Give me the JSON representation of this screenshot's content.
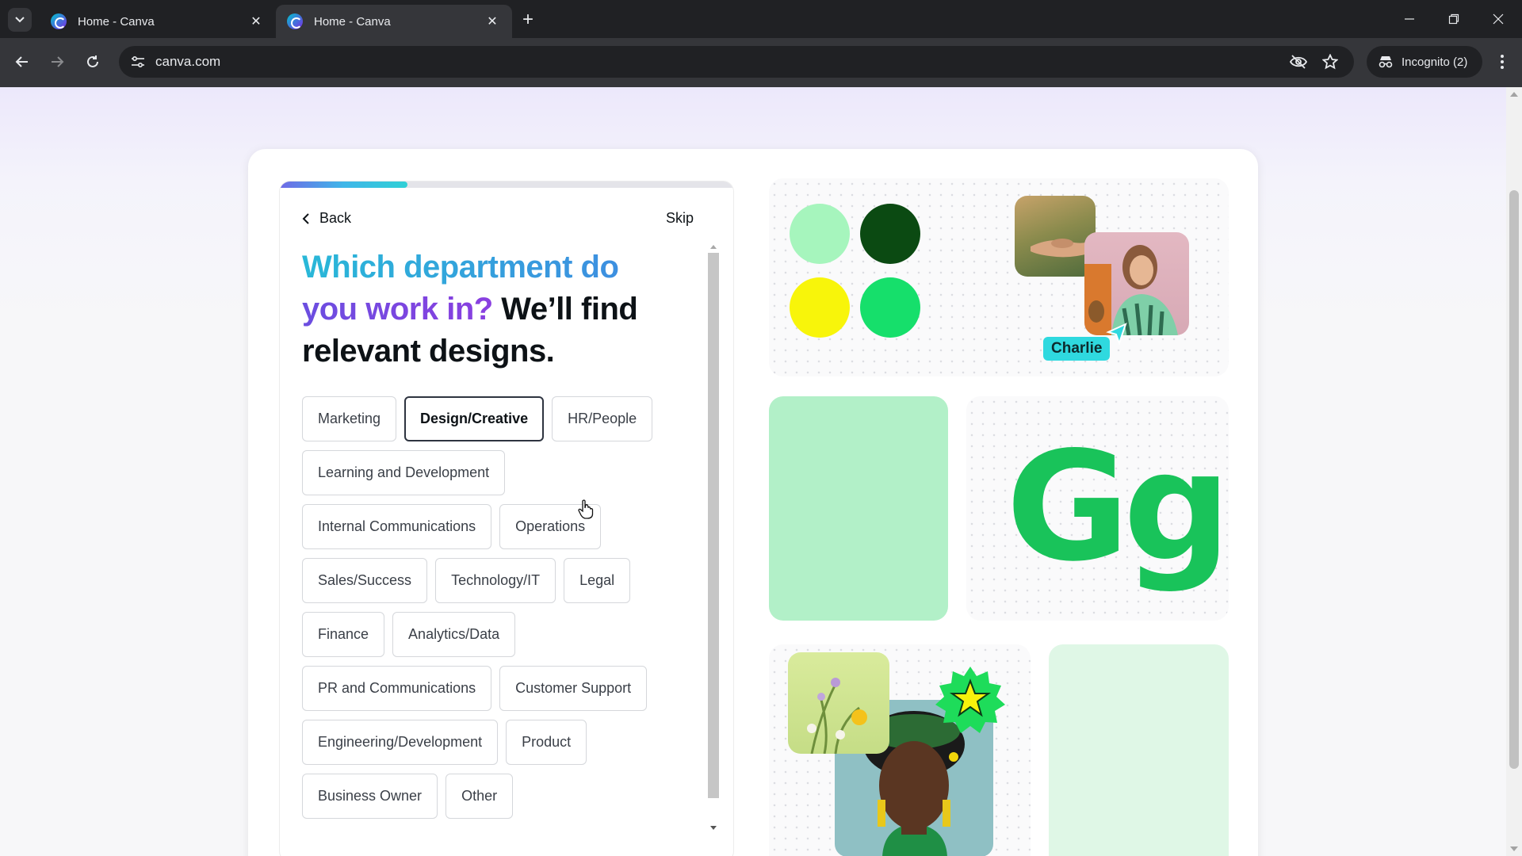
{
  "browser": {
    "tabs": [
      {
        "title": "Home - Canva",
        "active": false
      },
      {
        "title": "Home - Canva",
        "active": true
      }
    ],
    "url": "canva.com",
    "incognito_label": "Incognito (2)",
    "icons": {
      "tab_search": "chevron-down-icon",
      "close": "close-icon",
      "new_tab": "plus-icon",
      "back": "arrow-left-icon",
      "forward": "arrow-right-icon",
      "reload": "reload-icon",
      "site_info": "tune-icon",
      "eye_off": "eye-off-icon",
      "bookmark": "star-icon",
      "menu": "more-vert-icon"
    }
  },
  "onboarding": {
    "progress": 0.28,
    "back_label": "Back",
    "skip_label": "Skip",
    "heading": {
      "part1": "Which department do",
      "part2": "you work in?",
      "part3": " We’ll find relevant designs."
    },
    "departments": [
      {
        "label": "Marketing",
        "selected": false
      },
      {
        "label": "Design/Creative",
        "selected": true
      },
      {
        "label": "HR/People",
        "selected": false
      },
      {
        "label": "Learning and Development",
        "selected": false
      },
      {
        "label": "Internal Communications",
        "selected": false
      },
      {
        "label": "Operations",
        "selected": false
      },
      {
        "label": "Sales/Success",
        "selected": false
      },
      {
        "label": "Technology/IT",
        "selected": false
      },
      {
        "label": "Legal",
        "selected": false
      },
      {
        "label": "Finance",
        "selected": false
      },
      {
        "label": "Analytics/Data",
        "selected": false
      },
      {
        "label": "PR and Communications",
        "selected": false
      },
      {
        "label": "Customer Support",
        "selected": false
      },
      {
        "label": "Engineering/Development",
        "selected": false
      },
      {
        "label": "Product",
        "selected": false
      },
      {
        "label": "Business Owner",
        "selected": false
      },
      {
        "label": "Other",
        "selected": false
      }
    ]
  },
  "collage": {
    "swatch_colors": [
      "#a6f5bd",
      "#0b4a12",
      "#f8f50a",
      "#16df6b"
    ],
    "collaborator_name": "Charlie",
    "tag_color": "#2fd9df",
    "font_sample": "Gg",
    "font_sample_color": "#19c35a"
  }
}
